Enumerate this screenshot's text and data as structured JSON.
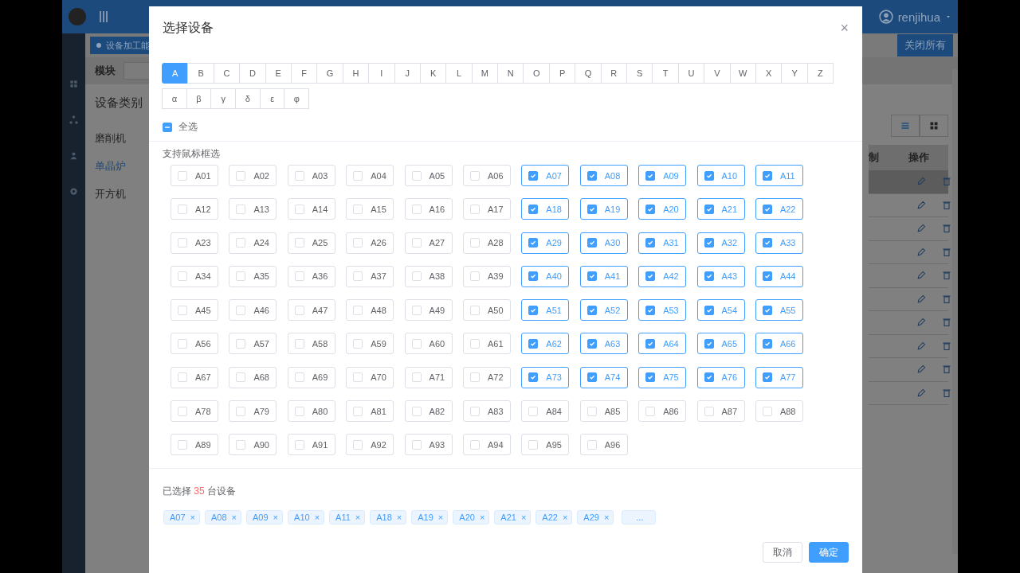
{
  "app": {
    "user": "renjihua",
    "close_all_button": "关闭所有",
    "tag": "设备加工能",
    "filter_label": "模块",
    "category_title": "设备类别",
    "categories": [
      {
        "label": "磨削机",
        "selected": false
      },
      {
        "label": "单晶炉",
        "selected": true
      },
      {
        "label": "开方机",
        "selected": false
      }
    ],
    "table": {
      "columns": [
        "制",
        "操作"
      ],
      "rows": [
        {
          "selected": true
        },
        {
          "selected": false
        },
        {
          "selected": false
        },
        {
          "selected": false
        },
        {
          "selected": false
        },
        {
          "selected": false
        },
        {
          "selected": false
        },
        {
          "selected": false
        },
        {
          "selected": false
        },
        {
          "selected": false
        }
      ]
    }
  },
  "dialog": {
    "title": "选择设备",
    "close": "×",
    "letters": [
      {
        "label": "A",
        "selected": true
      },
      {
        "label": "B",
        "selected": false
      },
      {
        "label": "C",
        "selected": false
      },
      {
        "label": "D",
        "selected": false
      },
      {
        "label": "E",
        "selected": false
      },
      {
        "label": "F",
        "selected": false
      },
      {
        "label": "G",
        "selected": false
      },
      {
        "label": "H",
        "selected": false
      },
      {
        "label": "I",
        "selected": false
      },
      {
        "label": "J",
        "selected": false
      },
      {
        "label": "K",
        "selected": false
      },
      {
        "label": "L",
        "selected": false
      },
      {
        "label": "M",
        "selected": false
      },
      {
        "label": "N",
        "selected": false
      },
      {
        "label": "O",
        "selected": false
      },
      {
        "label": "P",
        "selected": false
      },
      {
        "label": "Q",
        "selected": false
      },
      {
        "label": "R",
        "selected": false
      },
      {
        "label": "S",
        "selected": false
      },
      {
        "label": "T",
        "selected": false
      },
      {
        "label": "U",
        "selected": false
      },
      {
        "label": "V",
        "selected": false
      },
      {
        "label": "W",
        "selected": false
      },
      {
        "label": "X",
        "selected": false
      },
      {
        "label": "Y",
        "selected": false
      },
      {
        "label": "Z",
        "selected": false
      }
    ],
    "greek": [
      {
        "label": "α",
        "selected": false
      },
      {
        "label": "β",
        "selected": false
      },
      {
        "label": "γ",
        "selected": false
      },
      {
        "label": "δ",
        "selected": false
      },
      {
        "label": "ε",
        "selected": false
      },
      {
        "label": "φ",
        "selected": false
      }
    ],
    "select_all": {
      "label": "全选",
      "indeterminate": true
    },
    "hint": "支持鼠标框选",
    "devices": [
      {
        "label": "A01",
        "checked": false
      },
      {
        "label": "A02",
        "checked": false
      },
      {
        "label": "A03",
        "checked": false
      },
      {
        "label": "A04",
        "checked": false
      },
      {
        "label": "A05",
        "checked": false
      },
      {
        "label": "A06",
        "checked": false
      },
      {
        "label": "A07",
        "checked": true
      },
      {
        "label": "A08",
        "checked": true
      },
      {
        "label": "A09",
        "checked": true
      },
      {
        "label": "A10",
        "checked": true
      },
      {
        "label": "A11",
        "checked": true
      },
      {
        "label": "A12",
        "checked": false
      },
      {
        "label": "A13",
        "checked": false
      },
      {
        "label": "A14",
        "checked": false
      },
      {
        "label": "A15",
        "checked": false
      },
      {
        "label": "A16",
        "checked": false
      },
      {
        "label": "A17",
        "checked": false
      },
      {
        "label": "A18",
        "checked": true
      },
      {
        "label": "A19",
        "checked": true
      },
      {
        "label": "A20",
        "checked": true
      },
      {
        "label": "A21",
        "checked": true
      },
      {
        "label": "A22",
        "checked": true
      },
      {
        "label": "A23",
        "checked": false
      },
      {
        "label": "A24",
        "checked": false
      },
      {
        "label": "A25",
        "checked": false
      },
      {
        "label": "A26",
        "checked": false
      },
      {
        "label": "A27",
        "checked": false
      },
      {
        "label": "A28",
        "checked": false
      },
      {
        "label": "A29",
        "checked": true
      },
      {
        "label": "A30",
        "checked": true
      },
      {
        "label": "A31",
        "checked": true
      },
      {
        "label": "A32",
        "checked": true
      },
      {
        "label": "A33",
        "checked": true
      },
      {
        "label": "A34",
        "checked": false
      },
      {
        "label": "A35",
        "checked": false
      },
      {
        "label": "A36",
        "checked": false
      },
      {
        "label": "A37",
        "checked": false
      },
      {
        "label": "A38",
        "checked": false
      },
      {
        "label": "A39",
        "checked": false
      },
      {
        "label": "A40",
        "checked": true
      },
      {
        "label": "A41",
        "checked": true
      },
      {
        "label": "A42",
        "checked": true
      },
      {
        "label": "A43",
        "checked": true
      },
      {
        "label": "A44",
        "checked": true
      },
      {
        "label": "A45",
        "checked": false
      },
      {
        "label": "A46",
        "checked": false
      },
      {
        "label": "A47",
        "checked": false
      },
      {
        "label": "A48",
        "checked": false
      },
      {
        "label": "A49",
        "checked": false
      },
      {
        "label": "A50",
        "checked": false
      },
      {
        "label": "A51",
        "checked": true
      },
      {
        "label": "A52",
        "checked": true
      },
      {
        "label": "A53",
        "checked": true
      },
      {
        "label": "A54",
        "checked": true
      },
      {
        "label": "A55",
        "checked": true
      },
      {
        "label": "A56",
        "checked": false
      },
      {
        "label": "A57",
        "checked": false
      },
      {
        "label": "A58",
        "checked": false
      },
      {
        "label": "A59",
        "checked": false
      },
      {
        "label": "A60",
        "checked": false
      },
      {
        "label": "A61",
        "checked": false
      },
      {
        "label": "A62",
        "checked": true
      },
      {
        "label": "A63",
        "checked": true
      },
      {
        "label": "A64",
        "checked": true
      },
      {
        "label": "A65",
        "checked": true
      },
      {
        "label": "A66",
        "checked": true
      },
      {
        "label": "A67",
        "checked": false
      },
      {
        "label": "A68",
        "checked": false
      },
      {
        "label": "A69",
        "checked": false
      },
      {
        "label": "A70",
        "checked": false
      },
      {
        "label": "A71",
        "checked": false
      },
      {
        "label": "A72",
        "checked": false
      },
      {
        "label": "A73",
        "checked": true
      },
      {
        "label": "A74",
        "checked": true
      },
      {
        "label": "A75",
        "checked": true
      },
      {
        "label": "A76",
        "checked": true
      },
      {
        "label": "A77",
        "checked": true
      },
      {
        "label": "A78",
        "checked": false
      },
      {
        "label": "A79",
        "checked": false
      },
      {
        "label": "A80",
        "checked": false
      },
      {
        "label": "A81",
        "checked": false
      },
      {
        "label": "A82",
        "checked": false
      },
      {
        "label": "A83",
        "checked": false
      },
      {
        "label": "A84",
        "checked": false
      },
      {
        "label": "A85",
        "checked": false
      },
      {
        "label": "A86",
        "checked": false
      },
      {
        "label": "A87",
        "checked": false
      },
      {
        "label": "A88",
        "checked": false
      },
      {
        "label": "A89",
        "checked": false
      },
      {
        "label": "A90",
        "checked": false
      },
      {
        "label": "A91",
        "checked": false
      },
      {
        "label": "A92",
        "checked": false
      },
      {
        "label": "A93",
        "checked": false
      },
      {
        "label": "A94",
        "checked": false
      },
      {
        "label": "A95",
        "checked": false
      },
      {
        "label": "A96",
        "checked": false
      }
    ],
    "summary": {
      "prefix": "已选择",
      "count": "35",
      "suffix": "台设备"
    },
    "chips": [
      {
        "label": "A07",
        "remove": "×"
      },
      {
        "label": "A08",
        "remove": "×"
      },
      {
        "label": "A09",
        "remove": "×"
      },
      {
        "label": "A10",
        "remove": "×"
      },
      {
        "label": "A11",
        "remove": "×"
      },
      {
        "label": "A18",
        "remove": "×"
      },
      {
        "label": "A19",
        "remove": "×"
      },
      {
        "label": "A20",
        "remove": "×"
      },
      {
        "label": "A21",
        "remove": "×"
      },
      {
        "label": "A22",
        "remove": "×"
      },
      {
        "label": "A29",
        "remove": "×"
      }
    ],
    "more_chip": "...",
    "buttons": [
      {
        "kind": "cancel",
        "label": "取消"
      },
      {
        "kind": "confirm",
        "label": "确定"
      }
    ]
  }
}
